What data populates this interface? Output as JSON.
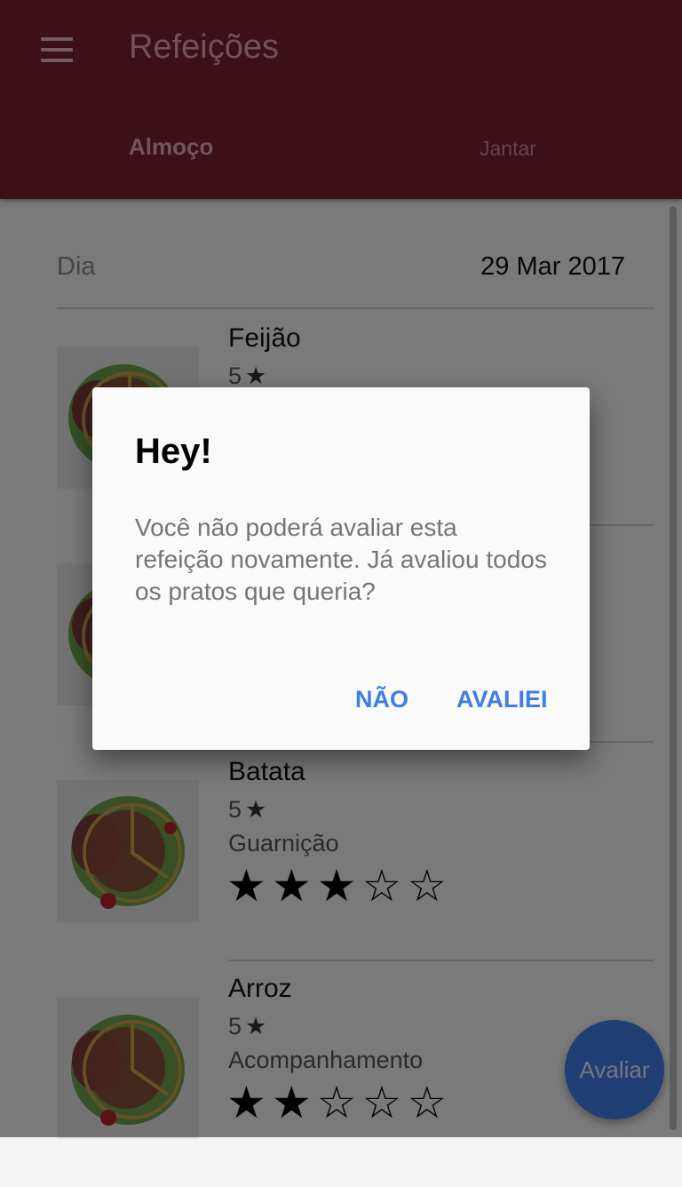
{
  "appbar": {
    "title": "Refeições",
    "tabs": [
      "Almoço",
      "Jantar"
    ]
  },
  "day": {
    "label": "Dia",
    "value": "29 Mar 2017"
  },
  "dishes": [
    {
      "name": "Feijão",
      "rating": "5",
      "category": "",
      "stars_filled": 0
    },
    {
      "name": "",
      "rating": "",
      "category": "",
      "stars_filled": 0
    },
    {
      "name": "Batata",
      "rating": "5",
      "category": "Guarnição",
      "stars_filled": 3
    },
    {
      "name": "Arroz",
      "rating": "5",
      "category": "Acompanhamento",
      "stars_filled": 2
    }
  ],
  "fab": {
    "label": "Avaliar"
  },
  "dialog": {
    "title": "Hey!",
    "message": "Você não poderá avaliar esta refeição novamente. Já avaliou todos os pratos que queria?",
    "buttons": {
      "no": "NÃO",
      "yes": "AVALIEI"
    }
  },
  "colors": {
    "primary": "#7a1f33",
    "accent": "#3f7de8"
  },
  "icons": {
    "menu": "menu-icon",
    "star": "star-icon"
  }
}
